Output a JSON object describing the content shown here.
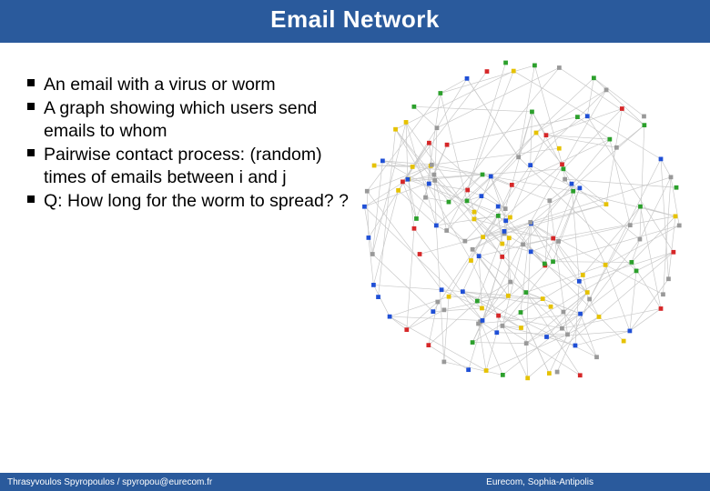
{
  "title": "Email Network",
  "bullets": [
    "An email with a virus or worm",
    "A graph showing which users send emails to whom",
    "Pairwise contact process: (random) times of emails between i and j",
    "Q: How long for the worm to spread? ?"
  ],
  "footer": {
    "left": "Thrasyvoulos Spyropoulos / spyropou@eurecom.fr",
    "right": "Eurecom, Sophia-Antipolis"
  },
  "graph": {
    "colors": {
      "edge": "#c8c8c8",
      "palette": [
        "#d62728",
        "#1f4fd6",
        "#2ca02c",
        "#e6c200",
        "#999999"
      ]
    }
  }
}
